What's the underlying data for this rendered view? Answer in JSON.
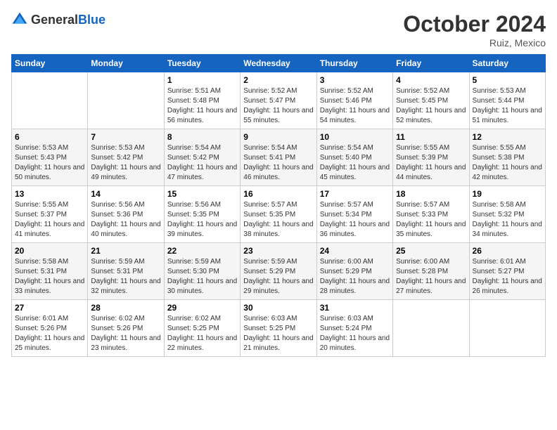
{
  "header": {
    "logo_general": "General",
    "logo_blue": "Blue",
    "month_title": "October 2024",
    "location": "Ruiz, Mexico"
  },
  "days_of_week": [
    "Sunday",
    "Monday",
    "Tuesday",
    "Wednesday",
    "Thursday",
    "Friday",
    "Saturday"
  ],
  "weeks": [
    {
      "days": [
        {
          "number": "",
          "sunrise": "",
          "sunset": "",
          "daylight": ""
        },
        {
          "number": "",
          "sunrise": "",
          "sunset": "",
          "daylight": ""
        },
        {
          "number": "1",
          "sunrise": "Sunrise: 5:51 AM",
          "sunset": "Sunset: 5:48 PM",
          "daylight": "Daylight: 11 hours and 56 minutes."
        },
        {
          "number": "2",
          "sunrise": "Sunrise: 5:52 AM",
          "sunset": "Sunset: 5:47 PM",
          "daylight": "Daylight: 11 hours and 55 minutes."
        },
        {
          "number": "3",
          "sunrise": "Sunrise: 5:52 AM",
          "sunset": "Sunset: 5:46 PM",
          "daylight": "Daylight: 11 hours and 54 minutes."
        },
        {
          "number": "4",
          "sunrise": "Sunrise: 5:52 AM",
          "sunset": "Sunset: 5:45 PM",
          "daylight": "Daylight: 11 hours and 52 minutes."
        },
        {
          "number": "5",
          "sunrise": "Sunrise: 5:53 AM",
          "sunset": "Sunset: 5:44 PM",
          "daylight": "Daylight: 11 hours and 51 minutes."
        }
      ]
    },
    {
      "days": [
        {
          "number": "6",
          "sunrise": "Sunrise: 5:53 AM",
          "sunset": "Sunset: 5:43 PM",
          "daylight": "Daylight: 11 hours and 50 minutes."
        },
        {
          "number": "7",
          "sunrise": "Sunrise: 5:53 AM",
          "sunset": "Sunset: 5:42 PM",
          "daylight": "Daylight: 11 hours and 49 minutes."
        },
        {
          "number": "8",
          "sunrise": "Sunrise: 5:54 AM",
          "sunset": "Sunset: 5:42 PM",
          "daylight": "Daylight: 11 hours and 47 minutes."
        },
        {
          "number": "9",
          "sunrise": "Sunrise: 5:54 AM",
          "sunset": "Sunset: 5:41 PM",
          "daylight": "Daylight: 11 hours and 46 minutes."
        },
        {
          "number": "10",
          "sunrise": "Sunrise: 5:54 AM",
          "sunset": "Sunset: 5:40 PM",
          "daylight": "Daylight: 11 hours and 45 minutes."
        },
        {
          "number": "11",
          "sunrise": "Sunrise: 5:55 AM",
          "sunset": "Sunset: 5:39 PM",
          "daylight": "Daylight: 11 hours and 44 minutes."
        },
        {
          "number": "12",
          "sunrise": "Sunrise: 5:55 AM",
          "sunset": "Sunset: 5:38 PM",
          "daylight": "Daylight: 11 hours and 42 minutes."
        }
      ]
    },
    {
      "days": [
        {
          "number": "13",
          "sunrise": "Sunrise: 5:55 AM",
          "sunset": "Sunset: 5:37 PM",
          "daylight": "Daylight: 11 hours and 41 minutes."
        },
        {
          "number": "14",
          "sunrise": "Sunrise: 5:56 AM",
          "sunset": "Sunset: 5:36 PM",
          "daylight": "Daylight: 11 hours and 40 minutes."
        },
        {
          "number": "15",
          "sunrise": "Sunrise: 5:56 AM",
          "sunset": "Sunset: 5:35 PM",
          "daylight": "Daylight: 11 hours and 39 minutes."
        },
        {
          "number": "16",
          "sunrise": "Sunrise: 5:57 AM",
          "sunset": "Sunset: 5:35 PM",
          "daylight": "Daylight: 11 hours and 38 minutes."
        },
        {
          "number": "17",
          "sunrise": "Sunrise: 5:57 AM",
          "sunset": "Sunset: 5:34 PM",
          "daylight": "Daylight: 11 hours and 36 minutes."
        },
        {
          "number": "18",
          "sunrise": "Sunrise: 5:57 AM",
          "sunset": "Sunset: 5:33 PM",
          "daylight": "Daylight: 11 hours and 35 minutes."
        },
        {
          "number": "19",
          "sunrise": "Sunrise: 5:58 AM",
          "sunset": "Sunset: 5:32 PM",
          "daylight": "Daylight: 11 hours and 34 minutes."
        }
      ]
    },
    {
      "days": [
        {
          "number": "20",
          "sunrise": "Sunrise: 5:58 AM",
          "sunset": "Sunset: 5:31 PM",
          "daylight": "Daylight: 11 hours and 33 minutes."
        },
        {
          "number": "21",
          "sunrise": "Sunrise: 5:59 AM",
          "sunset": "Sunset: 5:31 PM",
          "daylight": "Daylight: 11 hours and 32 minutes."
        },
        {
          "number": "22",
          "sunrise": "Sunrise: 5:59 AM",
          "sunset": "Sunset: 5:30 PM",
          "daylight": "Daylight: 11 hours and 30 minutes."
        },
        {
          "number": "23",
          "sunrise": "Sunrise: 5:59 AM",
          "sunset": "Sunset: 5:29 PM",
          "daylight": "Daylight: 11 hours and 29 minutes."
        },
        {
          "number": "24",
          "sunrise": "Sunrise: 6:00 AM",
          "sunset": "Sunset: 5:29 PM",
          "daylight": "Daylight: 11 hours and 28 minutes."
        },
        {
          "number": "25",
          "sunrise": "Sunrise: 6:00 AM",
          "sunset": "Sunset: 5:28 PM",
          "daylight": "Daylight: 11 hours and 27 minutes."
        },
        {
          "number": "26",
          "sunrise": "Sunrise: 6:01 AM",
          "sunset": "Sunset: 5:27 PM",
          "daylight": "Daylight: 11 hours and 26 minutes."
        }
      ]
    },
    {
      "days": [
        {
          "number": "27",
          "sunrise": "Sunrise: 6:01 AM",
          "sunset": "Sunset: 5:26 PM",
          "daylight": "Daylight: 11 hours and 25 minutes."
        },
        {
          "number": "28",
          "sunrise": "Sunrise: 6:02 AM",
          "sunset": "Sunset: 5:26 PM",
          "daylight": "Daylight: 11 hours and 23 minutes."
        },
        {
          "number": "29",
          "sunrise": "Sunrise: 6:02 AM",
          "sunset": "Sunset: 5:25 PM",
          "daylight": "Daylight: 11 hours and 22 minutes."
        },
        {
          "number": "30",
          "sunrise": "Sunrise: 6:03 AM",
          "sunset": "Sunset: 5:25 PM",
          "daylight": "Daylight: 11 hours and 21 minutes."
        },
        {
          "number": "31",
          "sunrise": "Sunrise: 6:03 AM",
          "sunset": "Sunset: 5:24 PM",
          "daylight": "Daylight: 11 hours and 20 minutes."
        },
        {
          "number": "",
          "sunrise": "",
          "sunset": "",
          "daylight": ""
        },
        {
          "number": "",
          "sunrise": "",
          "sunset": "",
          "daylight": ""
        }
      ]
    }
  ]
}
